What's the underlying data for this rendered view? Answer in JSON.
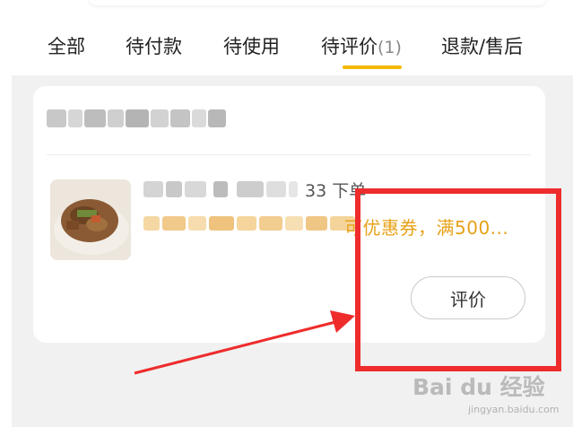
{
  "tabs": [
    {
      "label": "全部",
      "count": ""
    },
    {
      "label": "待付款",
      "count": ""
    },
    {
      "label": "待使用",
      "count": ""
    },
    {
      "label": "待评价",
      "count": "(1)"
    },
    {
      "label": "退款/售后",
      "count": ""
    }
  ],
  "active_tab": "待评价",
  "order": {
    "order_meta_suffix": "33 下单",
    "coupon_text": "可优惠券，满500...",
    "review_button_label": "评价"
  },
  "watermark": {
    "main": "Bai du 经验",
    "sub": "jingyan.baidu.com"
  },
  "colors": {
    "accent": "#f5b800",
    "coupon": "#e7a21a",
    "annotation": "#ee2c2c",
    "background": "#f1f1f1"
  }
}
